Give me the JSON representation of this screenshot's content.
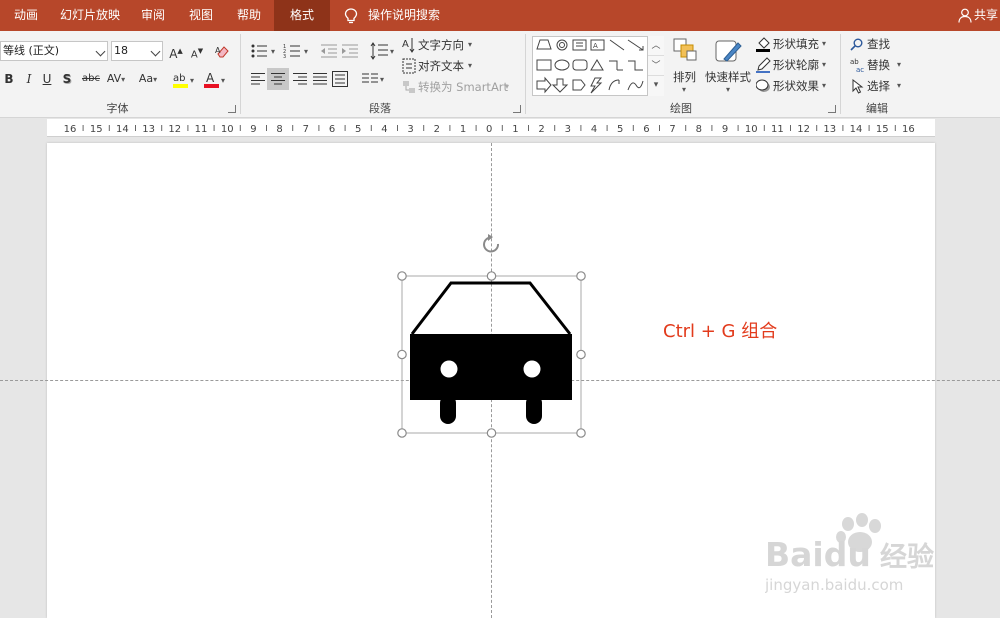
{
  "tabs": [
    {
      "label": "动画",
      "active": false
    },
    {
      "label": "幻灯片放映",
      "active": false
    },
    {
      "label": "审阅",
      "active": false
    },
    {
      "label": "视图",
      "active": false
    },
    {
      "label": "帮助",
      "active": false
    },
    {
      "label": "格式",
      "active": true
    }
  ],
  "tell_me": {
    "label": "操作说明搜索",
    "icon": "lightbulb-icon"
  },
  "share": {
    "label": "共享",
    "icon": "person-icon"
  },
  "font_group": {
    "label": "字体",
    "font_name": "等线 (正文)",
    "font_size": "18",
    "case_label": "Aa",
    "strike_label": "abc"
  },
  "paragraph_group": {
    "label": "段落",
    "text_direction": "文字方向",
    "align_text": "对齐文本",
    "convert_smartart": "转换为 SmartArt"
  },
  "drawing_group": {
    "label": "绘图",
    "arrange": "排列",
    "quick_styles": "快速样式",
    "shape_fill": "形状填充",
    "shape_outline": "形状轮廓",
    "shape_effects": "形状效果"
  },
  "editing_group": {
    "label": "编辑",
    "find": "查找",
    "replace": "替换",
    "select": "选择"
  },
  "ruler_labels": [
    "16",
    "15",
    "14",
    "13",
    "12",
    "11",
    "10",
    "9",
    "8",
    "7",
    "6",
    "5",
    "4",
    "3",
    "2",
    "1",
    "0",
    "1",
    "2",
    "3",
    "4",
    "5",
    "6",
    "7",
    "8",
    "9",
    "10",
    "11",
    "12",
    "13",
    "14",
    "15",
    "16"
  ],
  "annotation": "Ctrl + G  组合",
  "colors": {
    "accent": "#b7472a",
    "active_tab": "#8e3319",
    "annotation": "#e23b1c"
  },
  "watermark": {
    "brand": "Baidu",
    "cn": "经验",
    "url": "jingyan.baidu.com"
  }
}
